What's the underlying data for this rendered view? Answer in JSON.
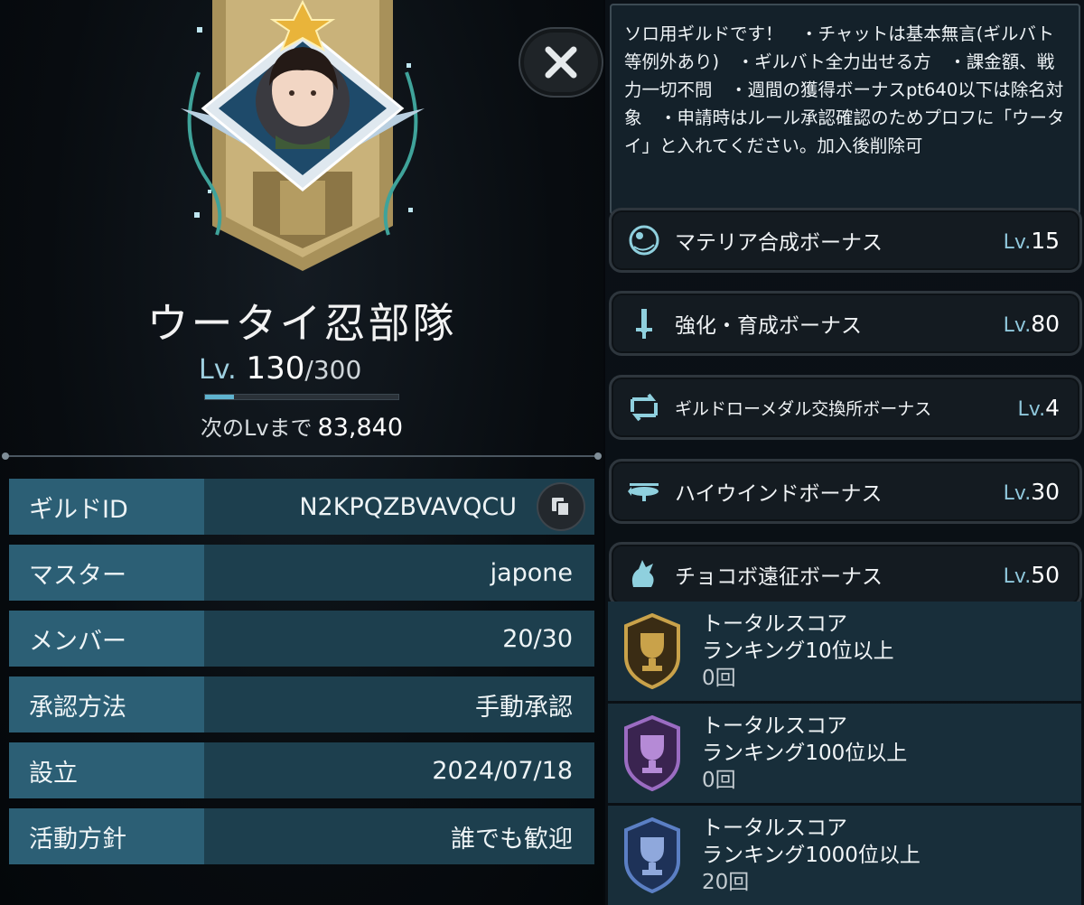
{
  "guild": {
    "name": "ウータイ忍部隊",
    "level_prefix": "Lv.",
    "level": "130",
    "level_max": "/300",
    "level_progress": 0.15,
    "next_level_label": "次のLvまで",
    "next_level_value": "83,840"
  },
  "info": [
    {
      "label": "ギルドID",
      "value": "N2KPQZBVAVQCU"
    },
    {
      "label": "マスター",
      "value": "japone"
    },
    {
      "label": "メンバー",
      "value": "20/30"
    },
    {
      "label": "承認方法",
      "value": "手動承認"
    },
    {
      "label": "設立",
      "value": "2024/07/18"
    },
    {
      "label": "活動方針",
      "value": "誰でも歓迎"
    }
  ],
  "description": "ソロ用ギルドです！　・チャットは基本無言(ギルバト等例外あり)　・ギルバト全力出せる方　・課金額、戦力一切不問　・週間の獲得ボーナスpt640以下は除名対象　・申請時はルール承認確認のためプロフに「ウータイ」と入れてください。加入後削除可",
  "bonuses": [
    {
      "label": "マテリア合成ボーナス",
      "lv_prefix": "Lv.",
      "level": "15",
      "icon": "materia-icon"
    },
    {
      "label": "強化・育成ボーナス",
      "lv_prefix": "Lv.",
      "level": "80",
      "icon": "sword-icon"
    },
    {
      "label": "ギルドローメダル交換所ボーナス",
      "lv_prefix": "Lv.",
      "level": "4",
      "icon": "exchange-icon"
    },
    {
      "label": "ハイウインドボーナス",
      "lv_prefix": "Lv.",
      "level": "30",
      "icon": "airship-icon"
    },
    {
      "label": "チョコボ遠征ボーナス",
      "lv_prefix": "Lv.",
      "level": "50",
      "icon": "chocobo-icon"
    }
  ],
  "scores": [
    {
      "title": "トータルスコア",
      "rank": "ランキング10位以上",
      "count": "0回",
      "badge": "gold-trophy-icon",
      "color": "#c9a24a"
    },
    {
      "title": "トータルスコア",
      "rank": "ランキング100位以上",
      "count": "0回",
      "badge": "purple-trophy-icon",
      "color": "#9b6cc2"
    },
    {
      "title": "トータルスコア",
      "rank": "ランキング1000位以上",
      "count": "20回",
      "badge": "blue-trophy-icon",
      "color": "#5b7fc4"
    }
  ],
  "colors": {
    "accent": "#5fb3cf",
    "label_bg": "#2c5f75",
    "value_bg": "#1d3f4e"
  }
}
